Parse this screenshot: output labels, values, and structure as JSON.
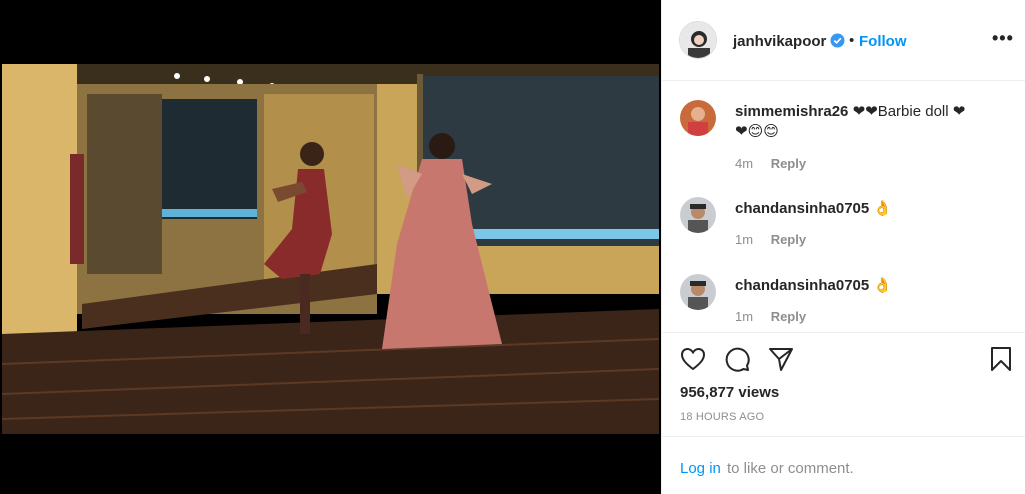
{
  "post": {
    "username": "janhvikapoor",
    "follow_label": "Follow",
    "more_label": "•••",
    "separator": "•"
  },
  "comments": [
    {
      "user": "simmemishra26",
      "text_line1": "❤❤Barbie doll ❤",
      "text_line2": "❤😊😊",
      "time": "4m",
      "reply": "Reply"
    },
    {
      "user": "chandansinha0705",
      "text": "👌",
      "time": "1m",
      "reply": "Reply"
    },
    {
      "user": "chandansinha0705",
      "text": "👌",
      "time": "1m",
      "reply": "Reply"
    }
  ],
  "actions": {
    "icons": [
      "heart-icon",
      "comment-icon",
      "share-icon",
      "bookmark-icon"
    ],
    "views": "956,877 views",
    "time_ago": "18 HOURS AGO"
  },
  "login": {
    "link": "Log in",
    "rest": "to like or comment."
  },
  "colors": {
    "accent": "#0095f6",
    "muted": "#8e8e8e",
    "text": "#262626"
  }
}
